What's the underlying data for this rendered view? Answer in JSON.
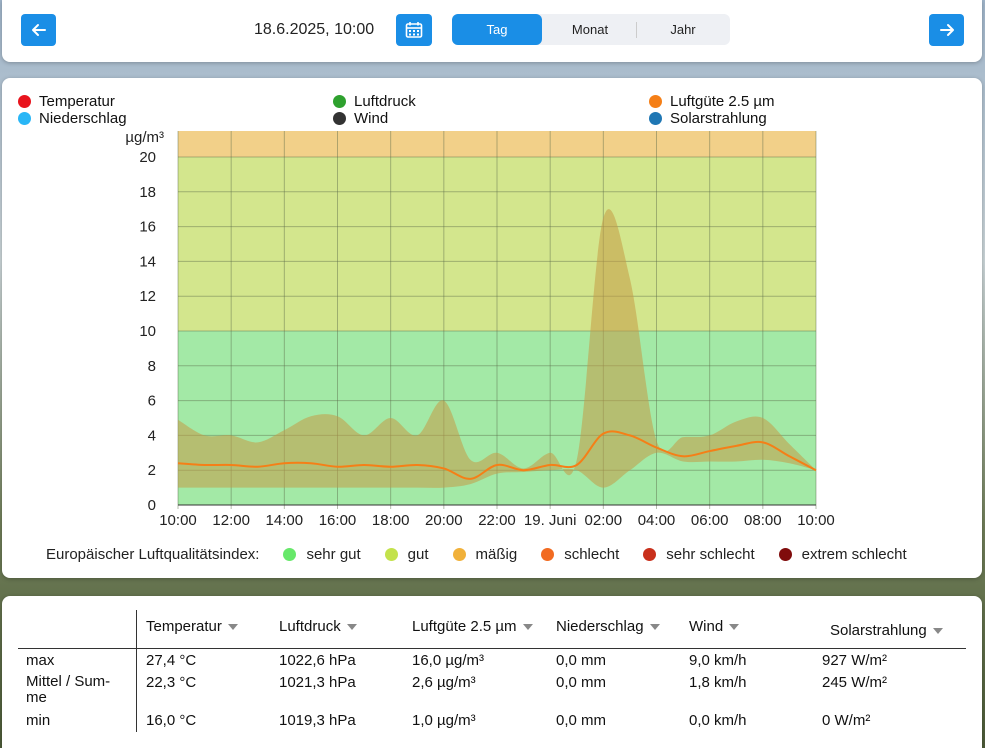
{
  "nav": {
    "date_label": "18.6.2025, 10:00",
    "tabs": [
      "Tag",
      "Monat",
      "Jahr"
    ],
    "active_tab": "Tag",
    "accent": "#1a8ee6"
  },
  "legend": [
    {
      "label": "Temperatur",
      "color": "#e8141d"
    },
    {
      "label": "Luftdruck",
      "color": "#2ea12e"
    },
    {
      "label": "Luftgüte 2.5 µm",
      "color": "#f57f17"
    },
    {
      "label": "Niederschlag",
      "color": "#29b6f6"
    },
    {
      "label": "Wind",
      "color": "#333333"
    },
    {
      "label": "Solarstrahlung",
      "color": "#1f77b4"
    }
  ],
  "chart_data": {
    "type": "area",
    "ylabel": "µg/m³",
    "ylim": [
      0,
      20
    ],
    "yticks": [
      "0",
      "2",
      "4",
      "6",
      "8",
      "10",
      "12",
      "14",
      "16",
      "18",
      "20"
    ],
    "xticks": [
      "10:00",
      "12:00",
      "14:00",
      "16:00",
      "18:00",
      "20:00",
      "22:00",
      "19. Juni",
      "02:00",
      "04:00",
      "06:00",
      "08:00",
      "10:00"
    ],
    "x_hours": [
      0,
      1,
      2,
      3,
      4,
      5,
      6,
      7,
      8,
      9,
      10,
      11,
      12,
      13,
      14,
      15,
      16,
      17,
      18,
      19,
      20,
      21,
      22,
      23,
      24
    ],
    "series": [
      {
        "name": "Luftgüte 2.5 µm",
        "color": "#f57f17",
        "values": [
          2.4,
          2.3,
          2.3,
          2.2,
          2.4,
          2.4,
          2.2,
          2.3,
          2.2,
          2.3,
          2.1,
          1.5,
          2.3,
          2.0,
          2.3,
          2.3,
          4.1,
          4.0,
          3.3,
          2.8,
          3.1,
          3.4,
          3.6,
          2.8,
          2.0
        ]
      },
      {
        "name": "Luftgüte 2.5 µm max",
        "color": "#c8a040",
        "values": [
          4.9,
          4.0,
          4.0,
          3.6,
          4.3,
          5.1,
          5.1,
          4.0,
          5.0,
          4.0,
          6.0,
          2.6,
          3.0,
          2.1,
          3.0,
          2.6,
          16.5,
          13.0,
          3.7,
          3.9,
          4.0,
          4.8,
          5.0,
          3.5,
          2.0
        ]
      },
      {
        "name": "Luftgüte 2.5 µm min",
        "color": "#c8a040",
        "values": [
          1.0,
          1.0,
          1.0,
          1.0,
          1.0,
          1.0,
          1.0,
          1.0,
          1.0,
          1.0,
          1.0,
          1.2,
          1.8,
          1.9,
          2.0,
          2.0,
          1.0,
          2.0,
          3.0,
          2.5,
          2.5,
          2.5,
          2.6,
          2.4,
          2.0
        ]
      }
    ],
    "bands": [
      {
        "from": 0,
        "to": 10,
        "color": "#a3e9a6"
      },
      {
        "from": 10,
        "to": 20,
        "color": "#d3e68d"
      },
      {
        "from": 20,
        "to": 21.5,
        "color": "#f2d089"
      }
    ]
  },
  "aqi": {
    "label": "Europäischer Luftqualitätsindex:",
    "items": [
      {
        "label": "sehr gut",
        "color": "#67e86a"
      },
      {
        "label": "gut",
        "color": "#c3e24c"
      },
      {
        "label": "mäßig",
        "color": "#f1b13a"
      },
      {
        "label": "schlecht",
        "color": "#f26b21"
      },
      {
        "label": "sehr schlecht",
        "color": "#c9301c"
      },
      {
        "label": "extrem schlecht",
        "color": "#800c0c"
      }
    ]
  },
  "table": {
    "headers": [
      "Temperatur",
      "Luftdruck",
      "Luftgüte 2.5 µm",
      "Niederschlag",
      "Wind",
      "Solarstrahlung"
    ],
    "rows": [
      {
        "label": "max",
        "values": [
          "27,4 °C",
          "1022,6 hPa",
          "16,0 µg/m³",
          "0,0 mm",
          "9,0 km/h",
          "927 W/m²"
        ]
      },
      {
        "label": "Mittel / Sum-me",
        "values": [
          "22,3 °C",
          "1021,3 hPa",
          "2,6 µg/m³",
          "0,0 mm",
          "1,8 km/h",
          "245 W/m²"
        ]
      },
      {
        "label": "min",
        "values": [
          "16,0 °C",
          "1019,3 hPa",
          "1,0 µg/m³",
          "0,0 mm",
          "0,0 km/h",
          "0 W/m²"
        ]
      }
    ]
  }
}
